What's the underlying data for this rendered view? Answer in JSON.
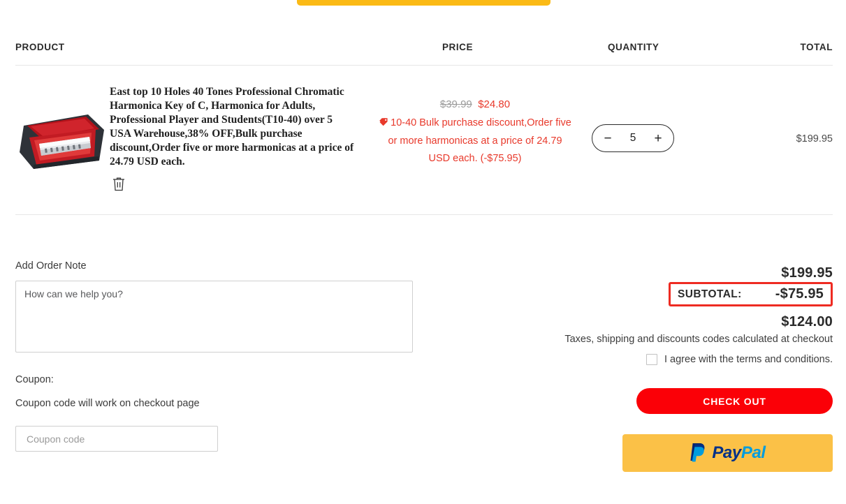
{
  "cart": {
    "headers": {
      "product": "PRODUCT",
      "price": "PRICE",
      "quantity": "QUANTITY",
      "total": "TOTAL"
    },
    "item": {
      "title": "East top 10 Holes 40 Tones Professional Chromatic Harmonica Key of C, Harmonica for Adults, Professional Player and Students(T10-40) over 5 USA Warehouse,38% OFF,Bulk purchase discount,Order five or more harmonicas at a price of 24.79 USD each.",
      "image_alt": "harmonica-in-case",
      "price_original": "$39.99",
      "price_sale": "$24.80",
      "discount_note": "10-40 Bulk purchase discount,Order five or more harmonicas at a price of 24.79 USD each. (-$75.95)",
      "quantity": "5",
      "decrease_label": "−",
      "increase_label": "+",
      "line_total": "$199.95",
      "remove_icon": "trash-icon",
      "tag_icon": "tag-icon"
    }
  },
  "order_note": {
    "label": "Add Order Note",
    "placeholder": "How can we help you?",
    "value": ""
  },
  "coupon": {
    "label": "Coupon:",
    "hint": "Coupon code will work on checkout page",
    "placeholder": "Coupon code",
    "value": ""
  },
  "summary": {
    "gross": "$199.95",
    "subtotal_label": "SUBTOTAL:",
    "subtotal_value": "-$75.95",
    "grand_total": "$124.00",
    "tax_note": "Taxes, shipping and discounts codes calculated at checkout",
    "terms_text": "I agree with the terms and conditions.",
    "terms_checked": false,
    "checkout_label": "CHECK OUT",
    "paypal_pay": "Pay",
    "paypal_pal": "Pal"
  },
  "colors": {
    "accent_red": "#fb0007",
    "sale_red": "#e8392b",
    "highlight_red": "#ee2b22",
    "paypal_yellow": "#fbc147",
    "top_strip_yellow": "#fbba16",
    "paypal_blue_dark": "#003087",
    "paypal_blue_light": "#009cde"
  }
}
